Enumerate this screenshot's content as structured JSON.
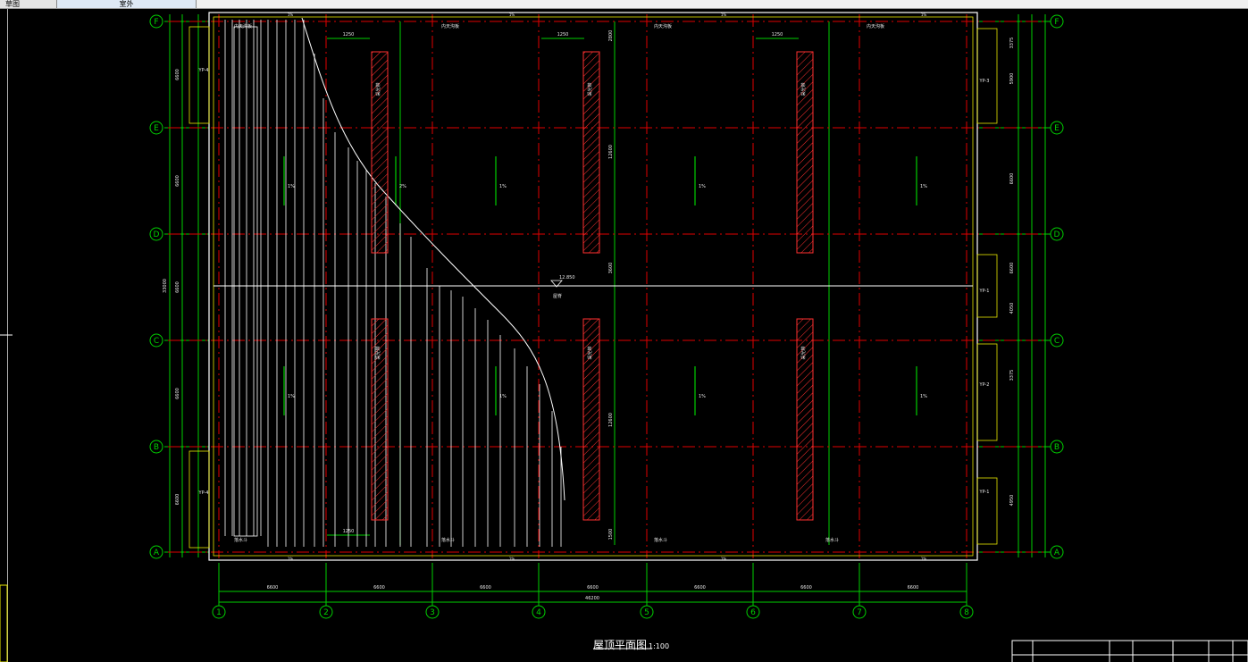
{
  "app": {
    "tabs": [
      {
        "label": "草图"
      },
      {
        "label": "室外"
      }
    ]
  },
  "drawing": {
    "title": "屋顶平面图",
    "scale": "1:100",
    "grid_columns": [
      "1",
      "2",
      "3",
      "4",
      "5",
      "6",
      "7",
      "8"
    ],
    "grid_rows": [
      "F",
      "E",
      "D",
      "C",
      "B",
      "A"
    ],
    "bay_dims": [
      "6600",
      "6600",
      "6600",
      "6600",
      "6600",
      "6600",
      "6600"
    ],
    "total_width": "46200",
    "left_row_dims": [
      "6600",
      "6600",
      "6600",
      "6600",
      "6600"
    ],
    "left_total": "33000",
    "slope_label": "1%",
    "slope_label_alt": "2%",
    "skylight_label": "采光带",
    "eave_label": "檐口",
    "gutter_label": "内天沟板",
    "gutter_label_b": "落水斗",
    "downpipe_tags": [
      "YP-1",
      "YP-2",
      "YP-3",
      "YP-4"
    ],
    "right_dims": [
      "3375",
      "5900",
      "6600",
      "6600",
      "4050",
      "3375",
      "4950"
    ],
    "ridge_label": "屋脊",
    "ridge_elev": "12.850",
    "skylight_dims": [
      "1250",
      "1250",
      "1250",
      "1250"
    ],
    "vertical_dims": [
      "2800",
      "12600",
      "3600",
      "12600",
      "1500"
    ]
  },
  "colors": {
    "grid_axis": "#00d000",
    "axis_line": "#e00000",
    "roof": "#ffffff",
    "text": "#e8e8e8",
    "yellow": "#e8e800"
  }
}
